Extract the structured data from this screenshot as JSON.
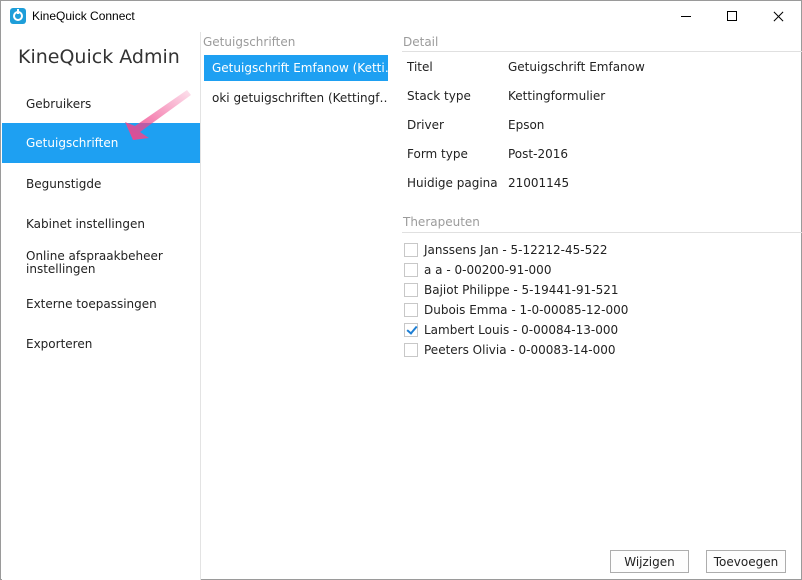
{
  "window": {
    "title": "KineQuick Connect"
  },
  "sidebar": {
    "title": "KineQuick Admin",
    "items": [
      {
        "label": "Gebruikers"
      },
      {
        "label": "Getuigschriften",
        "active": true
      },
      {
        "label": "Begunstigde"
      },
      {
        "label": "Kabinet instellingen"
      },
      {
        "label": "Online afspraakbeheer instellingen"
      },
      {
        "label": "Externe toepassingen"
      },
      {
        "label": "Exporteren"
      }
    ]
  },
  "list": {
    "header": "Getuigschriften",
    "items": [
      {
        "label": "Getuigschrift Emfanow (Ketti…",
        "selected": true
      },
      {
        "label": "oki getuigschriften (Kettingf…"
      }
    ]
  },
  "detail": {
    "header": "Detail",
    "rows": [
      {
        "label": "Titel",
        "value": "Getuigschrift Emfanow"
      },
      {
        "label": "Stack type",
        "value": "Kettingformulier"
      },
      {
        "label": "Driver",
        "value": "Epson"
      },
      {
        "label": "Form type",
        "value": "Post-2016"
      },
      {
        "label": "Huidige pagina",
        "value": "21001145"
      }
    ]
  },
  "therapists": {
    "header": "Therapeuten",
    "items": [
      {
        "label": "Janssens Jan - 5-12212-45-522",
        "checked": false
      },
      {
        "label": "a a - 0-00200-91-000",
        "checked": false
      },
      {
        "label": "Bajiot Philippe - 5-19441-91-521",
        "checked": false
      },
      {
        "label": "Dubois Emma - 1-0-00085-12-000",
        "checked": false
      },
      {
        "label": "Lambert Louis - 0-00084-13-000",
        "checked": true
      },
      {
        "label": "Peeters Olivia - 0-00083-14-000",
        "checked": false
      }
    ]
  },
  "buttons": {
    "edit_label": "Wijzigen",
    "add_label": "Toevoegen"
  },
  "colors": {
    "accent": "#1ea0f2",
    "annotation_arrow": "#f0468c"
  }
}
